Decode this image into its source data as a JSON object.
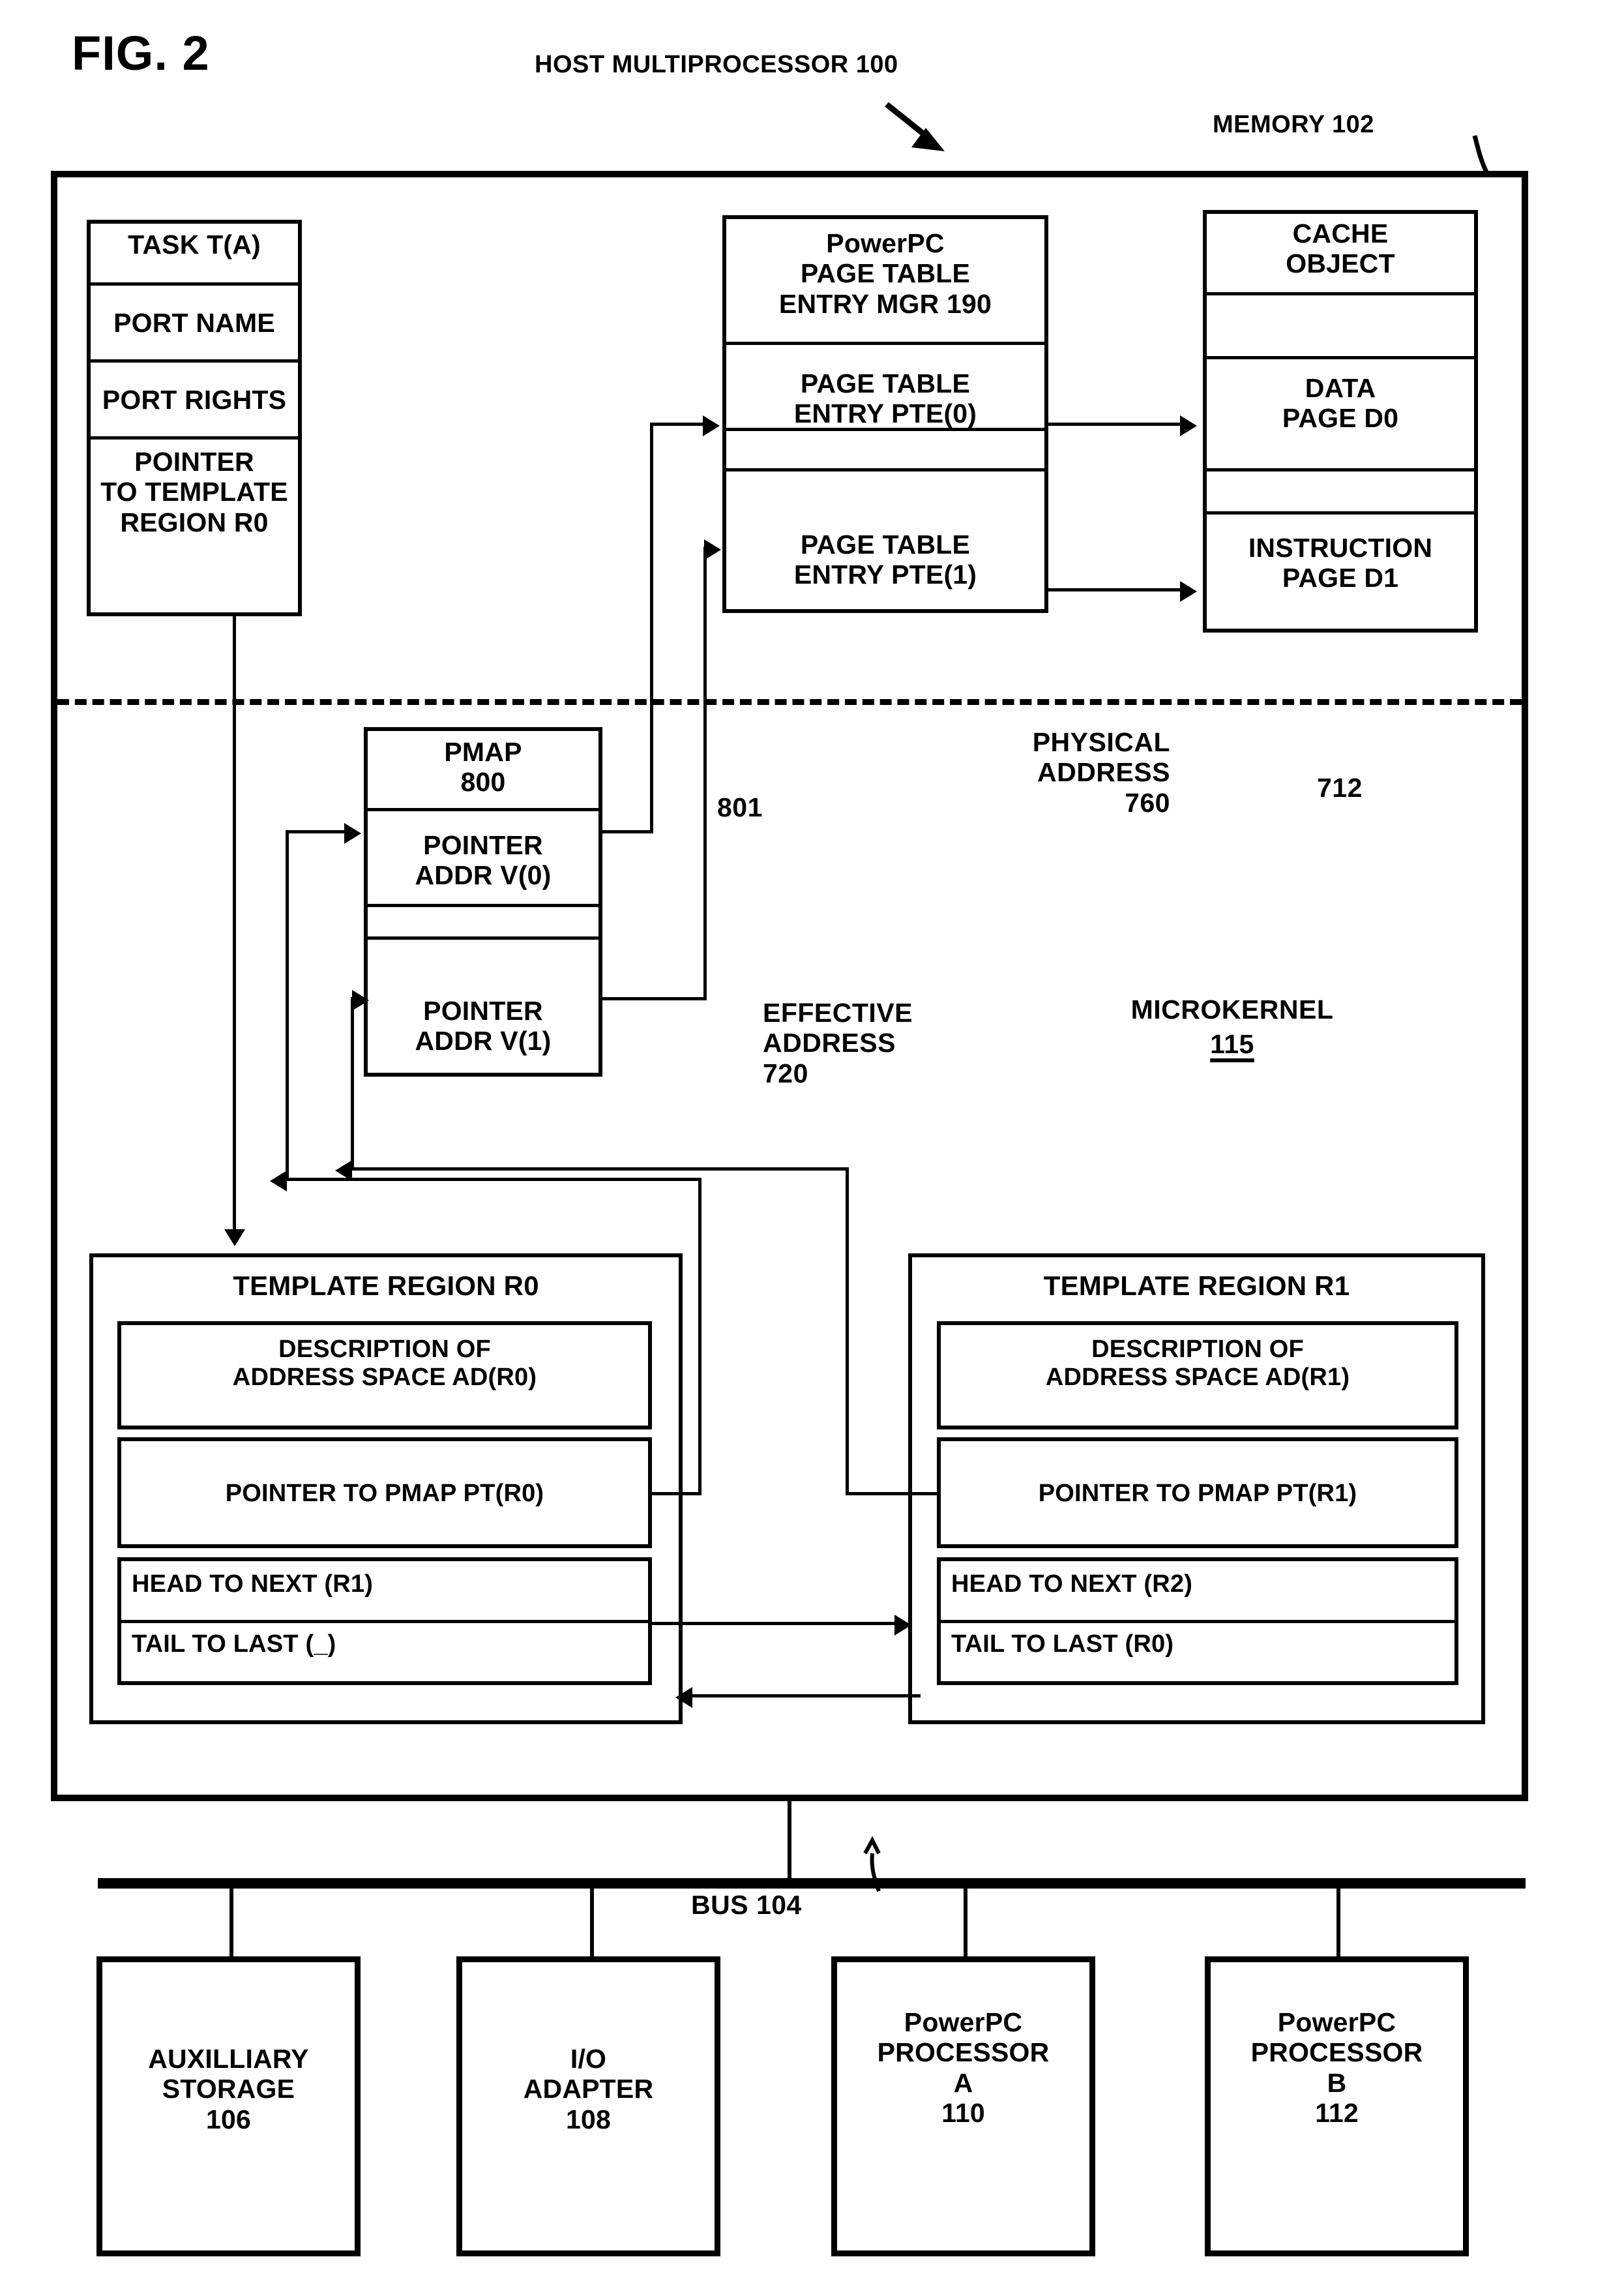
{
  "figure": {
    "title": "FIG. 2",
    "host_label": "HOST MULTIPROCESSOR 100",
    "memory_label": "MEMORY 102"
  },
  "task_box": {
    "title": "TASK T(A)",
    "rows": [
      "PORT NAME",
      "PORT RIGHTS",
      "POINTER\nTO TEMPLATE\nREGION R0"
    ]
  },
  "pte_mgr_box": {
    "title": "PowerPC\nPAGE TABLE\nENTRY MGR 190",
    "rows": [
      "PAGE TABLE\nENTRY PTE(0)",
      "",
      "PAGE TABLE\nENTRY PTE(1)"
    ]
  },
  "cache_object_box": {
    "title": "CACHE\nOBJECT",
    "rows": [
      "",
      "DATA\nPAGE  D0",
      "",
      "INSTRUCTION\nPAGE  D1"
    ]
  },
  "pmap_box": {
    "title": "PMAP\n800",
    "rows": [
      "POINTER\nADDR V(0)",
      "",
      "POINTER\nADDR V(1)"
    ]
  },
  "template_region_r0": {
    "title": "TEMPLATE REGION R0",
    "description": "DESCRIPTION OF\nADDRESS SPACE AD(R0)",
    "pointer": "POINTER TO PMAP PT(R0)",
    "head": "HEAD TO NEXT (R1)",
    "tail": "TAIL TO LAST (_)"
  },
  "template_region_r1": {
    "title": "TEMPLATE REGION R1",
    "description": "DESCRIPTION OF\nADDRESS SPACE AD(R1)",
    "pointer": "POINTER TO PMAP PT(R1)",
    "head": "HEAD TO NEXT (R2)",
    "tail": "TAIL TO LAST (R0)"
  },
  "annotations": {
    "physical_address": "PHYSICAL\nADDRESS\n760",
    "effective_address": "EFFECTIVE\nADDRESS\n720",
    "microkernel": "MICROKERNEL",
    "microkernel_num": "115",
    "ref_801": "801",
    "ref_712": "712",
    "bus": "BUS 104"
  },
  "bottom_boxes": [
    {
      "label": "AUXILLIARY\nSTORAGE\n106"
    },
    {
      "label": "I/O\nADAPTER\n108"
    },
    {
      "label": "PowerPC\nPROCESSOR\nA\n110"
    },
    {
      "label": "PowerPC\nPROCESSOR\nB\n112"
    }
  ],
  "colors": {
    "ink": "#000000",
    "paper": "#ffffff"
  }
}
